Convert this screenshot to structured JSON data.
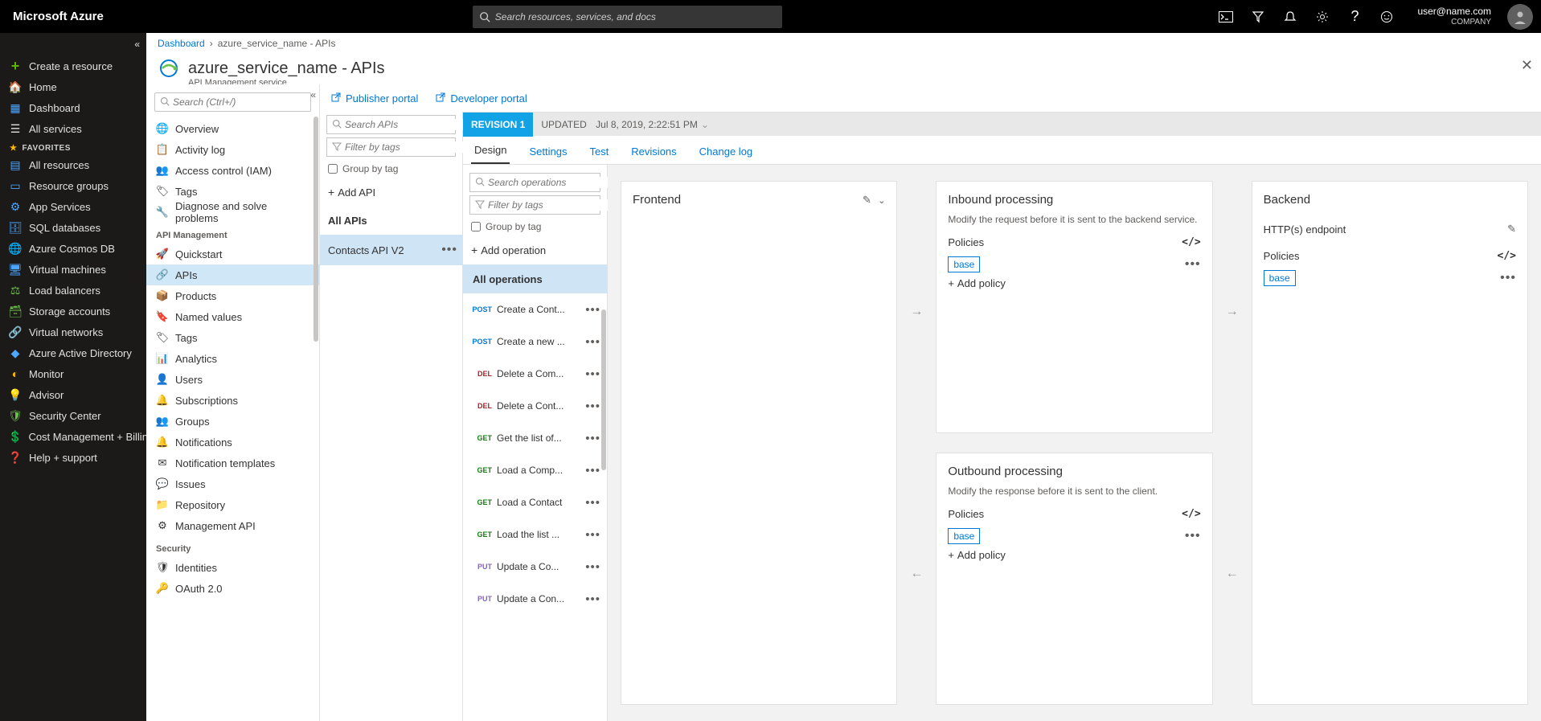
{
  "brand": "Microsoft Azure",
  "search_placeholder": "Search resources, services, and docs",
  "user": {
    "email": "user@name.com",
    "company": "COMPANY"
  },
  "leftnav": {
    "create": "Create a resource",
    "home": "Home",
    "dashboard": "Dashboard",
    "all_services": "All services",
    "favorites_label": "FAVORITES",
    "items": [
      "All resources",
      "Resource groups",
      "App Services",
      "SQL databases",
      "Azure Cosmos DB",
      "Virtual machines",
      "Load balancers",
      "Storage accounts",
      "Virtual networks",
      "Azure Active Directory",
      "Monitor",
      "Advisor",
      "Security Center",
      "Cost Management + Billing",
      "Help + support"
    ]
  },
  "breadcrumb": {
    "root": "Dashboard",
    "current": "azure_service_name - APIs"
  },
  "page": {
    "title": "azure_service_name - APIs",
    "subtitle": "API Management service"
  },
  "resmenu": {
    "search_placeholder": "Search (Ctrl+/)",
    "top": [
      {
        "label": "Overview",
        "icon": "globe"
      },
      {
        "label": "Activity log",
        "icon": "log"
      },
      {
        "label": "Access control (IAM)",
        "icon": "iam"
      },
      {
        "label": "Tags",
        "icon": "tag"
      },
      {
        "label": "Diagnose and solve problems",
        "icon": "diag"
      }
    ],
    "group1_label": "API Management",
    "group1": [
      {
        "label": "Quickstart",
        "icon": "rocket"
      },
      {
        "label": "APIs",
        "icon": "api",
        "active": true
      },
      {
        "label": "Products",
        "icon": "products"
      },
      {
        "label": "Named values",
        "icon": "named"
      },
      {
        "label": "Tags",
        "icon": "tag"
      },
      {
        "label": "Analytics",
        "icon": "analytics"
      },
      {
        "label": "Users",
        "icon": "users"
      },
      {
        "label": "Subscriptions",
        "icon": "subs"
      },
      {
        "label": "Groups",
        "icon": "groups"
      },
      {
        "label": "Notifications",
        "icon": "notif"
      },
      {
        "label": "Notification templates",
        "icon": "mail"
      },
      {
        "label": "Issues",
        "icon": "issues"
      },
      {
        "label": "Repository",
        "icon": "repo"
      },
      {
        "label": "Management API",
        "icon": "mgmt"
      }
    ],
    "group2_label": "Security",
    "group2": [
      {
        "label": "Identities",
        "icon": "shield"
      },
      {
        "label": "OAuth 2.0",
        "icon": "oauth"
      }
    ]
  },
  "portalbar": {
    "publisher": "Publisher portal",
    "developer": "Developer portal"
  },
  "apicol": {
    "search_placeholder": "Search APIs",
    "filter_placeholder": "Filter by tags",
    "group_by_tag": "Group by tag",
    "add_api": "Add API",
    "all_apis": "All APIs",
    "items": [
      {
        "label": "Contacts API V2",
        "active": true
      }
    ]
  },
  "revision": {
    "badge": "REVISION 1",
    "updated_label": "UPDATED",
    "updated_time": "Jul 8, 2019, 2:22:51 PM"
  },
  "tabs": [
    "Design",
    "Settings",
    "Test",
    "Revisions",
    "Change log"
  ],
  "active_tab": "Design",
  "opcol": {
    "search_placeholder": "Search operations",
    "filter_placeholder": "Filter by tags",
    "group_by_tag": "Group by tag",
    "add_operation": "Add operation",
    "all_operations": "All operations",
    "ops": [
      {
        "verb": "POST",
        "vclass": "post",
        "name": "Create a Cont..."
      },
      {
        "verb": "POST",
        "vclass": "post",
        "name": "Create a new ..."
      },
      {
        "verb": "DEL",
        "vclass": "del",
        "name": "Delete a Com..."
      },
      {
        "verb": "DEL",
        "vclass": "del",
        "name": "Delete a Cont..."
      },
      {
        "verb": "GET",
        "vclass": "get",
        "name": "Get the list of..."
      },
      {
        "verb": "GET",
        "vclass": "get",
        "name": "Load a Comp..."
      },
      {
        "verb": "GET",
        "vclass": "get",
        "name": "Load a Contact"
      },
      {
        "verb": "GET",
        "vclass": "get",
        "name": "Load the list ..."
      },
      {
        "verb": "PUT",
        "vclass": "put",
        "name": "Update a Co..."
      },
      {
        "verb": "PUT",
        "vclass": "put",
        "name": "Update a Con..."
      }
    ]
  },
  "cards": {
    "frontend": {
      "title": "Frontend"
    },
    "inbound": {
      "title": "Inbound processing",
      "desc": "Modify the request before it is sent to the backend service.",
      "policies": "Policies",
      "base": "base",
      "add_policy": "Add policy"
    },
    "outbound": {
      "title": "Outbound processing",
      "desc": "Modify the response before it is sent to the client.",
      "policies": "Policies",
      "base": "base",
      "add_policy": "Add policy"
    },
    "backend": {
      "title": "Backend",
      "endpoint": "HTTP(s) endpoint",
      "policies": "Policies",
      "base": "base"
    }
  }
}
